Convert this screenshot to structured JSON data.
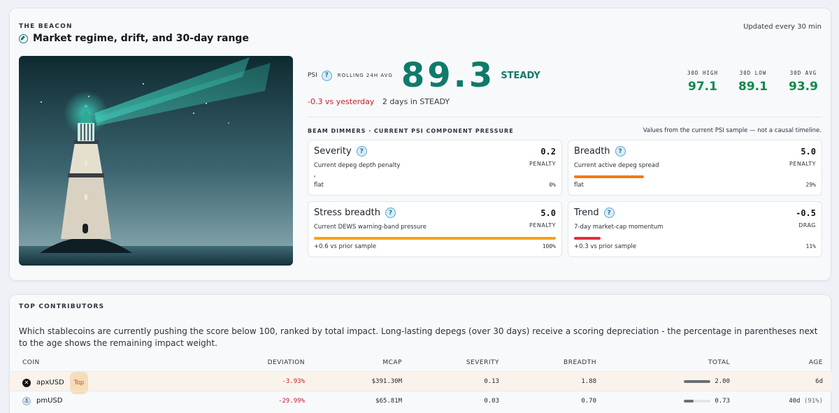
{
  "beacon": {
    "eyebrow": "THE BEACON",
    "title": "Market regime, drift, and 30-day range",
    "updated": "Updated every 30 min",
    "icon": "compass-icon"
  },
  "psi": {
    "label": "PSI",
    "rolling": "ROLLING 24H AVG",
    "value": "89.3",
    "state": "STEADY",
    "delta": "-0.3 vs yesterday",
    "days": "2 days in STEADY",
    "value_color": "#0f7a6c",
    "delta_color": "#c2202a"
  },
  "stats": [
    {
      "label": "30D HIGH",
      "value": "97.1"
    },
    {
      "label": "30D LOW",
      "value": "89.1"
    },
    {
      "label": "30D AVG",
      "value": "93.9"
    }
  ],
  "dimmers": {
    "eyebrow": "BEAM DIMMERS · CURRENT PSI COMPONENT PRESSURE",
    "note": "Values from the current PSI sample — not a causal timeline.",
    "items": [
      {
        "title": "Severity",
        "value": "0.2",
        "unit": "PENALTY",
        "sub": "Current depeg depth penalty",
        "trend": "flat",
        "pct": "0%",
        "fill": 0.0,
        "color": "#f59f1c"
      },
      {
        "title": "Breadth",
        "value": "5.0",
        "unit": "PENALTY",
        "sub": "Current active depeg spread",
        "trend": "flat",
        "pct": "29%",
        "fill": 0.29,
        "color": "#f07a1a"
      },
      {
        "title": "Stress breadth",
        "value": "5.0",
        "unit": "PENALTY",
        "sub": "Current DEWS warning-band pressure",
        "trend": "+0.6 vs prior sample",
        "pct": "100%",
        "fill": 1.0,
        "color": "#f5a31a"
      },
      {
        "title": "Trend",
        "value": "-0.5",
        "unit": "DRAG",
        "sub": "7-day market-cap momentum",
        "trend": "+0.3 vs prior sample",
        "pct": "11%",
        "fill": 0.11,
        "color": "#e52e3c"
      }
    ]
  },
  "contributors": {
    "eyebrow": "TOP CONTRIBUTORS",
    "description": "Which stablecoins are currently pushing the score below 100, ranked by total impact. Long-lasting depegs (over 30 days) receive a scoring depreciation - the percentage in parentheses next to the age shows the remaining impact weight.",
    "columns": {
      "coin": "COIN",
      "deviation": "DEVIATION",
      "mcap": "MCAP",
      "severity": "SEVERITY",
      "breadth": "BREADTH",
      "total": "TOTAL",
      "age": "AGE"
    },
    "rows": [
      {
        "coin": "apxUSD",
        "badge": "Top",
        "deviation": "-3.93%",
        "mcap": "$391.30M",
        "severity": "0.13",
        "breadth": "1.88",
        "total": "2.00",
        "total_fill": 1.0,
        "age": "6d",
        "age_extra": "",
        "icon": "x-circle-icon"
      },
      {
        "coin": "pmUSD",
        "badge": "",
        "deviation": "-29.99%",
        "mcap": "$65.81M",
        "severity": "0.03",
        "breadth": "0.70",
        "total": "0.73",
        "total_fill": 0.36,
        "age": "40d",
        "age_extra": "(91%)",
        "icon": "pm-coin-icon"
      }
    ]
  }
}
